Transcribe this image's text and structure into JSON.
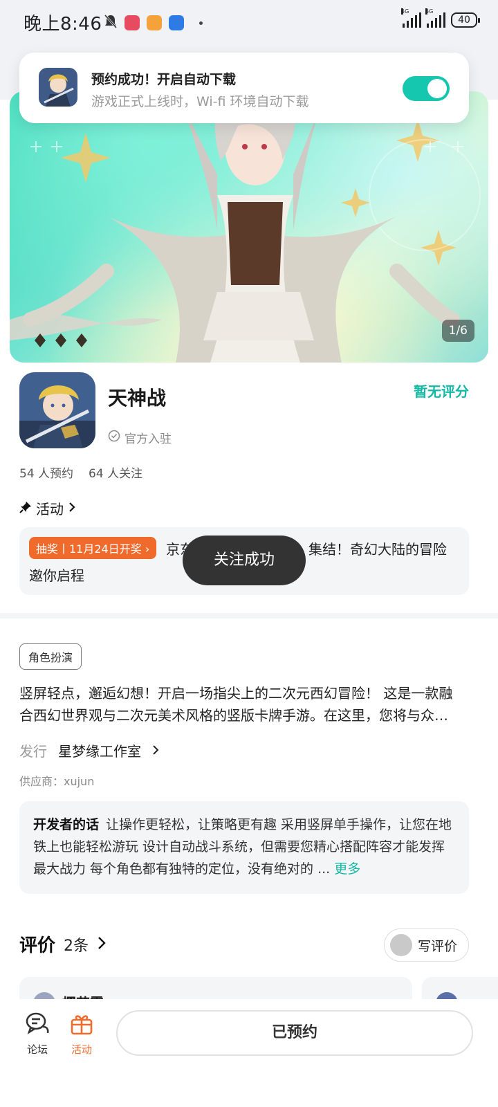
{
  "status_bar": {
    "time": "晚上8:46",
    "network_1": "5G",
    "network_2": "5G",
    "battery": "40"
  },
  "notification": {
    "title": "预约成功！开启自动下载",
    "subtitle": "游戏正式上线时，Wi-fi 环境自动下载",
    "auto_download_enabled": true
  },
  "banner": {
    "counter": "1/6"
  },
  "game": {
    "title": "天神战",
    "rating_text": "暂无评分",
    "official_badge": "官方入驻",
    "reservations": "54 人预约",
    "followers": "64 人关注"
  },
  "activity": {
    "heading": "活动",
    "tag": "抽奖丨11月24日开奖",
    "text_line1": "京东",
    "text_line1_tail": "集结！奇幻大陆的冒险",
    "text_line2": "邀你启程"
  },
  "toast": {
    "text": "关注成功"
  },
  "details": {
    "genre": "角色扮演",
    "description_line1": "竖屏轻点，邂逅幻想！开启一场指尖上的二次元西幻冒险！ 这是一款融",
    "description_line2": "合西幻世界观与二次元美术风格的竖版卡牌手游。在这里，您将与众…",
    "publisher_label": "发行",
    "publisher_name": "星梦缘工作室",
    "supplier": "供应商：xujun"
  },
  "developer_note": {
    "label": "开发者的话",
    "text": "让操作更轻松，让策略更有趣 采用竖屏单手操作，让您在地铁上也能轻松游玩 设计自动战斗系统，但需要您精心搭配阵容才能发挥最大战力 每个角色都有独特的定位，没有绝对的 ...",
    "more": "更多"
  },
  "reviews": {
    "title": "评价",
    "count": "2条",
    "write_button": "写评价",
    "first_reviewer": "樱花雾"
  },
  "bottom_bar": {
    "forum": "论坛",
    "activity": "活动",
    "primary_button": "已预约"
  },
  "colors": {
    "accent_teal": "#13b9a5",
    "toggle_on": "#14c7ae",
    "accent_orange": "#f06a2c"
  }
}
